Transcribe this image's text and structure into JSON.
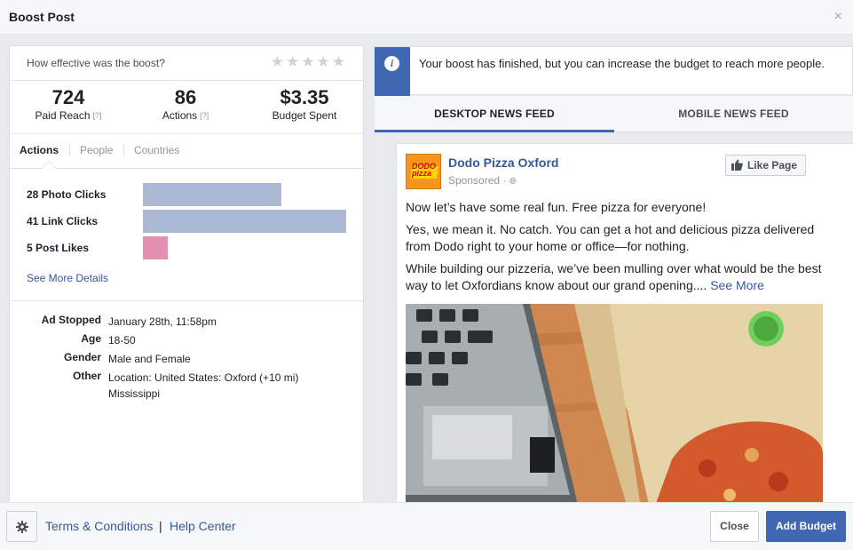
{
  "dialog": {
    "title": "Boost Post",
    "close_glyph": "×"
  },
  "rating": {
    "question": "How effective was the boost?",
    "stars": 5
  },
  "stats": [
    {
      "value": "724",
      "label": "Paid Reach",
      "help": "[?]"
    },
    {
      "value": "86",
      "label": "Actions",
      "help": "[?]"
    },
    {
      "value": "$3.35",
      "label": "Budget Spent",
      "help": ""
    }
  ],
  "tabs": [
    "Actions",
    "People",
    "Countries"
  ],
  "actions": [
    {
      "label": "28 Photo Clicks",
      "value": 28,
      "color": "#aab8d4"
    },
    {
      "label": "41 Link Clicks",
      "value": 41,
      "color": "#aab8d4"
    },
    {
      "label": "5 Post Likes",
      "value": 5,
      "color": "#e38fb1"
    }
  ],
  "actions_max": 41,
  "see_more_details": "See More Details",
  "details": [
    {
      "key": "Ad Stopped",
      "value": "January 28th, 11:58pm"
    },
    {
      "key": "Age",
      "value": "18-50"
    },
    {
      "key": "Gender",
      "value": "Male and Female"
    },
    {
      "key": "Other",
      "value": "Location: United States: Oxford (+10 mi) Mississippi"
    }
  ],
  "notice": {
    "text": "Your boost has finished, but you can increase the budget to reach more people.",
    "icon": "info-icon"
  },
  "feed_tabs": [
    "DESKTOP NEWS FEED",
    "MOBILE NEWS FEED"
  ],
  "post": {
    "page_name": "Dodo Pizza Oxford",
    "logo_text": "DODO pizza",
    "sponsored": "Sponsored · ",
    "like_label": "Like Page",
    "paragraphs": [
      "Now let’s have some real fun. Free pizza for everyone!",
      "Yes, we mean it. No catch. You can get a hot and delicious pizza delivered from Dodo right to your home or office—for nothing.",
      "While building our pizzeria, we’ve been mulling over what would be the best way to let Oxfordians know about our grand opening...."
    ],
    "see_more": "See More"
  },
  "footer": {
    "terms": "Terms & Conditions",
    "separator": "|",
    "help": "Help Center",
    "close": "Close",
    "add_budget": "Add Budget"
  },
  "colors": {
    "accent": "#4267b2",
    "link": "#365899"
  }
}
